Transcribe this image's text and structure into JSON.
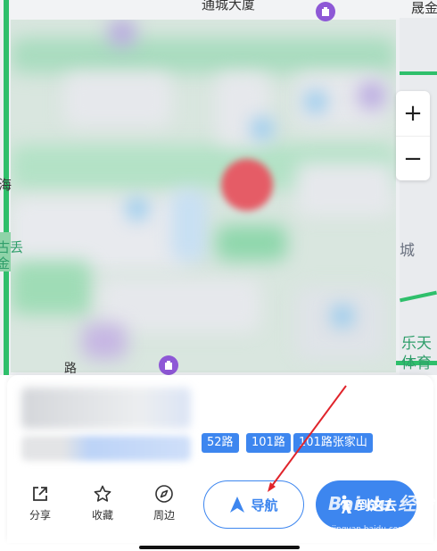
{
  "map": {
    "labels": {
      "top_center": "通城大厦",
      "top_right": "晟金",
      "left_mid": "海",
      "right_mid": "城",
      "right_bottom_1": "乐天",
      "right_bottom_2": "体育",
      "left_bottom": "古丢\n金",
      "bottom_road": "路"
    },
    "zoom_in": "+",
    "zoom_out": "−"
  },
  "card": {
    "routes": [
      "52路",
      "101路",
      "101路张家山"
    ],
    "actions": {
      "share": "分享",
      "favorite": "收藏",
      "nearby": "周边"
    },
    "navigate": "导航",
    "go_here": "到这去"
  },
  "watermark": {
    "main": "Bai du 经验",
    "sub": "jingyan.baidu.com"
  },
  "colors": {
    "accent": "#3d86ef",
    "pin": "#e55c66",
    "arrow": "#e0242b"
  }
}
